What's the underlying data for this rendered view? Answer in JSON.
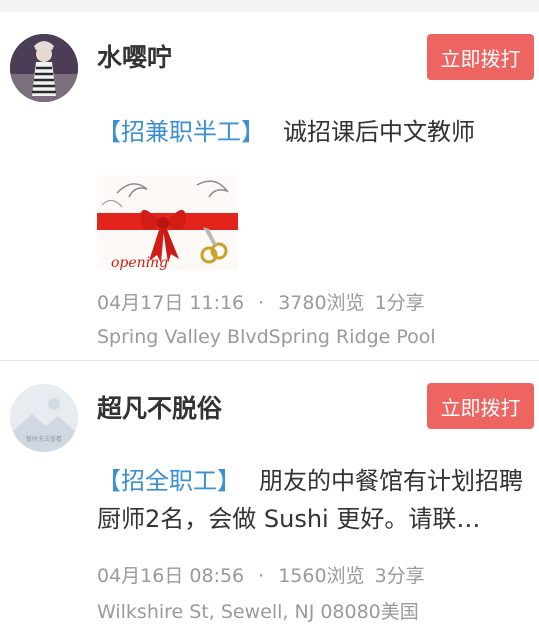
{
  "posts": [
    {
      "user": "水嘤咛",
      "call_label": "立即拨打",
      "tag": "【招兼职半工】",
      "text": "诚招课后中文教师",
      "datetime": "04月17日 11:16",
      "dot": "·",
      "views": "3780浏览",
      "shares": "1分享",
      "location": "Spring Valley BlvdSpring Ridge Pool"
    },
    {
      "user": "超凡不脱俗",
      "call_label": "立即拨打",
      "avatar_text": "暂时无法查看",
      "tag": "【招全职工】",
      "text": "朋友的中餐馆有计划招聘厨师2名，会做 Sushi 更好。请联…",
      "datetime": "04月16日 08:56",
      "dot": "·",
      "views": "1560浏览",
      "shares": "3分享",
      "location": "Wilkshire St, Sewell, NJ 08080美国"
    }
  ],
  "colors": {
    "call_button": "#ee6461",
    "tag": "#3a90d3",
    "meta": "#9a9a9a"
  },
  "icons": {
    "post1_avatar": "user-photo-avatar",
    "post1_image": "grand-opening-ribbon-image",
    "post2_avatar": "placeholder-mountain-avatar"
  }
}
